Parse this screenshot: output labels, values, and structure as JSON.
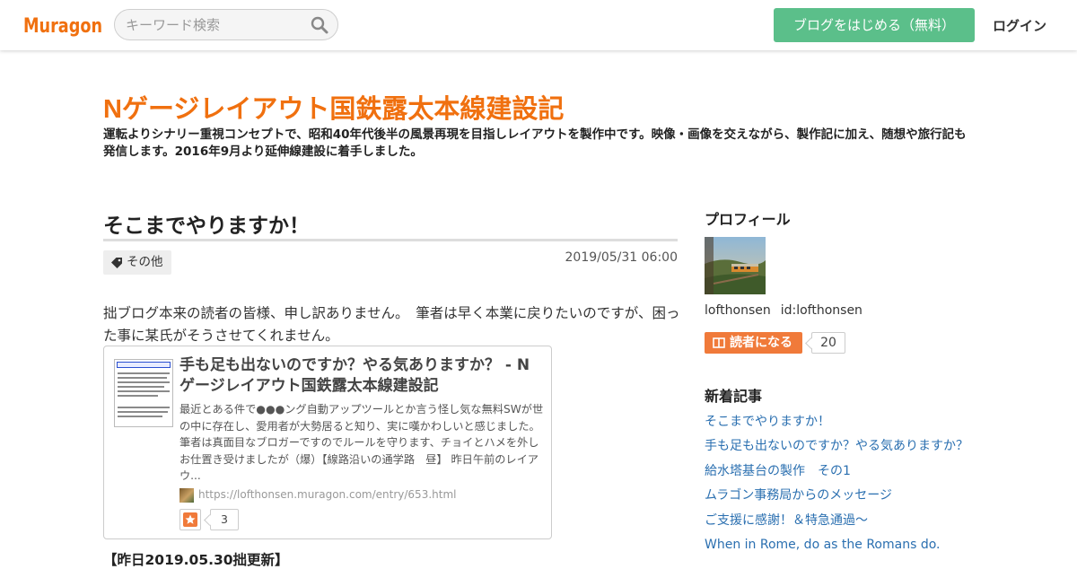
{
  "header": {
    "logo_text": "Muragon",
    "search_placeholder": "キーワード検索",
    "start_button": "ブログをはじめる（無料）",
    "login": "ログイン"
  },
  "blog": {
    "title": "Nゲージレイアウト国鉄露太本線建設記",
    "description": "運転よりシナリー重視コンセプトで、昭和40年代後半の風景再現を目指しレイアウトを製作中です。映像・画像を交えながら、製作記に加え、随想や旅行記も発信します。2016年9月より延伸線建設に着手しました。"
  },
  "article": {
    "title": "そこまでやりますか！",
    "category": "その他",
    "date": "2019/05/31 06:00",
    "body": "拙ブログ本来の読者の皆様、申し訳ありません。　筆者は早く本業に戻りたいのですが、困った事に某氏がそうさせてくれません。",
    "embed": {
      "title": "手も足も出ないのですか？やる気ありますか？ - Nゲージレイアウト国鉄露太本線建設記",
      "description": "最近とある件で●●●ング自動アップツールとか言う怪し気な無料SWが世の中に存在し、愛用者が大勢居ると知り、実に嘆かわしいと感じました。　筆者は真面目なブロガーですのでルールを守ります、チョイとハメを外しお仕置き受けましたが（爆）【線路沿いの通学路　昼】 昨日午前のレイアウ...",
      "url": "https://lofthonsen.muragon.com/entry/653.html",
      "star_count": "3"
    },
    "update_heading": "【昨日2019.05.30拙更新】"
  },
  "sidebar": {
    "profile_heading": "プロフィール",
    "username": "lofthonsen",
    "user_id": "id:lofthonsen",
    "subscribe_label": "読者になる",
    "subscriber_count": "20",
    "recent_heading": "新着記事",
    "recent_articles": [
      "そこまでやりますか！",
      "手も足も出ないのですか？やる気ありますか？",
      "給水塔基台の製作　その1",
      "ムラゴン事務局からのメッセージ",
      "ご支援に感謝！＆特急通過～",
      "When in Rome, do as the Romans do."
    ]
  },
  "colors": {
    "brand_orange": "#f0700f",
    "start_button_green": "#5bbf8a",
    "subscribe_orange": "#f07a3a",
    "link_blue": "#2a6fb0"
  }
}
